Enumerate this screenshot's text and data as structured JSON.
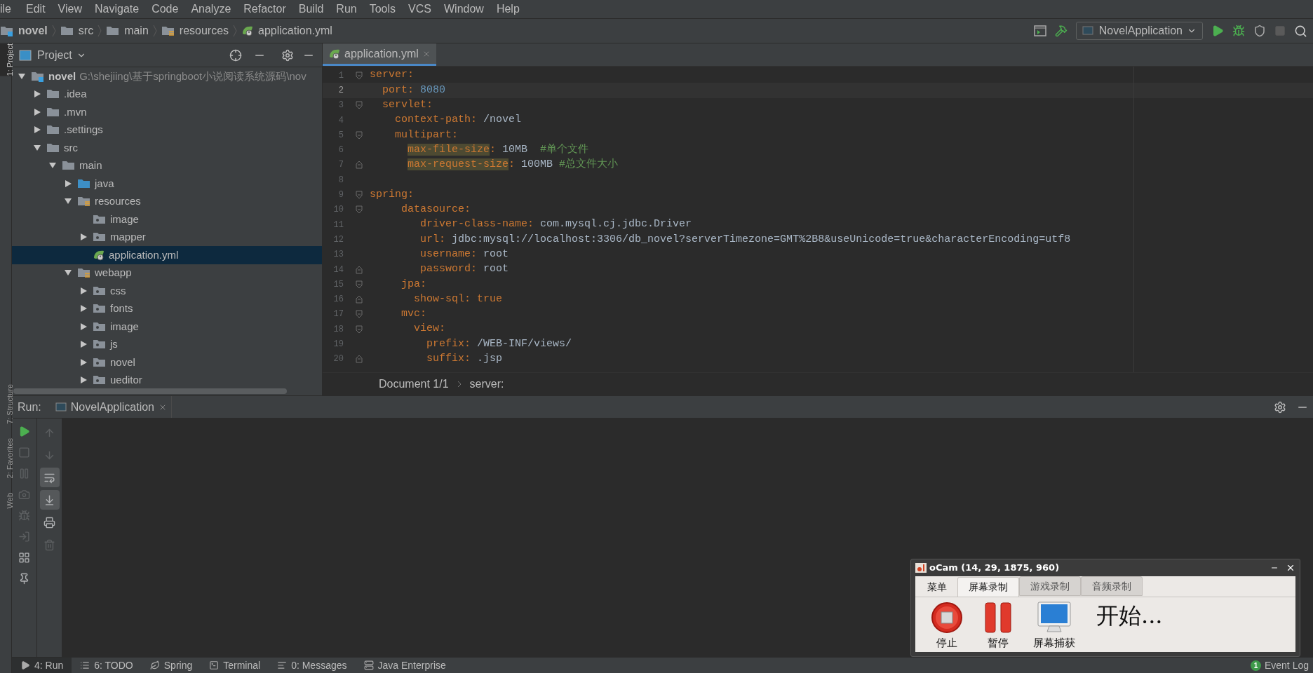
{
  "menu": [
    "ile",
    "Edit",
    "View",
    "Navigate",
    "Code",
    "Analyze",
    "Refactor",
    "Build",
    "Run",
    "Tools",
    "VCS",
    "Window",
    "Help"
  ],
  "breadcrumbs": [
    {
      "label": "novel",
      "kind": "module"
    },
    {
      "label": "src",
      "kind": "folder"
    },
    {
      "label": "main",
      "kind": "folder"
    },
    {
      "label": "resources",
      "kind": "resources"
    },
    {
      "label": "application.yml",
      "kind": "spring"
    }
  ],
  "toolbar": {
    "run_config": "NovelApplication"
  },
  "side_strip": [
    {
      "label": "1: Project",
      "selected": true
    },
    {
      "label": "7: Structure",
      "selected": false
    },
    {
      "label": "2: Favorites",
      "selected": false
    },
    {
      "label": "Web",
      "selected": false
    }
  ],
  "project": {
    "title": "Project",
    "tree": [
      {
        "name": "novel",
        "path": "G:\\shejiing\\基于springboot小说阅读系统源码\\nov",
        "kind": "module",
        "expanded": true,
        "selected": false,
        "children": [
          {
            "name": ".idea",
            "kind": "folder",
            "expanded": false,
            "selected": false
          },
          {
            "name": ".mvn",
            "kind": "folder",
            "expanded": false,
            "selected": false
          },
          {
            "name": ".settings",
            "kind": "folder",
            "expanded": false,
            "selected": false
          },
          {
            "name": "src",
            "kind": "folder",
            "expanded": true,
            "selected": false,
            "children": [
              {
                "name": "main",
                "kind": "folder",
                "expanded": true,
                "selected": false,
                "children": [
                  {
                    "name": "java",
                    "kind": "source",
                    "expanded": false,
                    "selected": false
                  },
                  {
                    "name": "resources",
                    "kind": "resources",
                    "expanded": true,
                    "selected": false,
                    "children": [
                      {
                        "name": "image",
                        "kind": "package",
                        "selected": false
                      },
                      {
                        "name": "mapper",
                        "kind": "package",
                        "expanded": false,
                        "selected": false
                      },
                      {
                        "name": "application.yml",
                        "kind": "spring",
                        "selected": true
                      }
                    ]
                  },
                  {
                    "name": "webapp",
                    "kind": "resources",
                    "expanded": true,
                    "selected": false,
                    "children": [
                      {
                        "name": "css",
                        "kind": "package",
                        "expanded": false,
                        "selected": false
                      },
                      {
                        "name": "fonts",
                        "kind": "package",
                        "expanded": false,
                        "selected": false
                      },
                      {
                        "name": "image",
                        "kind": "package",
                        "expanded": false,
                        "selected": false
                      },
                      {
                        "name": "js",
                        "kind": "package",
                        "expanded": false,
                        "selected": false
                      },
                      {
                        "name": "novel",
                        "kind": "package",
                        "expanded": false,
                        "selected": false
                      },
                      {
                        "name": "ueditor",
                        "kind": "package",
                        "expanded": false,
                        "selected": false
                      }
                    ]
                  }
                ]
              }
            ]
          }
        ]
      }
    ]
  },
  "editor": {
    "tabs": [
      {
        "label": "application.yml",
        "selected": true
      }
    ],
    "lines": [
      {
        "number": "1",
        "kind": "fold-start",
        "current": false,
        "tokens": [
          {
            "kind": "key",
            "text": "server"
          },
          {
            "kind": "punct",
            "text": ":"
          }
        ]
      },
      {
        "number": "2",
        "kind": "plain",
        "current": true,
        "tokens": [
          {
            "kind": "key",
            "text": "  port"
          },
          {
            "kind": "punct",
            "text": ": "
          },
          {
            "kind": "number",
            "text": "8080"
          }
        ]
      },
      {
        "number": "3",
        "kind": "fold-start",
        "current": false,
        "tokens": [
          {
            "kind": "key",
            "text": "  servlet"
          },
          {
            "kind": "punct",
            "text": ":"
          }
        ]
      },
      {
        "number": "4",
        "kind": "plain",
        "current": false,
        "tokens": [
          {
            "kind": "key",
            "text": "    context-path"
          },
          {
            "kind": "punct",
            "text": ": "
          },
          {
            "kind": "value",
            "text": "/novel"
          }
        ]
      },
      {
        "number": "5",
        "kind": "fold-start",
        "current": false,
        "tokens": [
          {
            "kind": "key",
            "text": "    multipart"
          },
          {
            "kind": "punct",
            "text": ":"
          }
        ]
      },
      {
        "number": "6",
        "kind": "plain",
        "current": false,
        "tokens": [
          {
            "kind": "marked-key",
            "text": "      max-file-size"
          },
          {
            "kind": "punct",
            "text": ": "
          },
          {
            "kind": "value",
            "text": "10MB  "
          },
          {
            "kind": "comment",
            "text": "#单个文件"
          }
        ]
      },
      {
        "number": "7",
        "kind": "fold-end",
        "current": false,
        "tokens": [
          {
            "kind": "marked-key",
            "text": "      max-request-size"
          },
          {
            "kind": "punct",
            "text": ": "
          },
          {
            "kind": "value",
            "text": "100MB "
          },
          {
            "kind": "comment",
            "text": "#总文件大小"
          }
        ]
      },
      {
        "number": "8",
        "kind": "plain",
        "current": false
      },
      {
        "number": "9",
        "kind": "fold-start",
        "current": false,
        "tokens": [
          {
            "kind": "key",
            "text": "spring"
          },
          {
            "kind": "punct",
            "text": ":"
          }
        ]
      },
      {
        "number": "10",
        "kind": "fold-start",
        "current": false,
        "tokens": [
          {
            "kind": "key",
            "text": "     datasource"
          },
          {
            "kind": "punct",
            "text": ":"
          }
        ]
      },
      {
        "number": "11",
        "kind": "plain",
        "current": false,
        "tokens": [
          {
            "kind": "key",
            "text": "        driver-class-name"
          },
          {
            "kind": "punct",
            "text": ": "
          },
          {
            "kind": "value",
            "text": "com.mysql.cj.jdbc.Driver"
          }
        ]
      },
      {
        "number": "12",
        "kind": "plain",
        "current": false,
        "tokens": [
          {
            "kind": "key",
            "text": "        url"
          },
          {
            "kind": "punct",
            "text": ": "
          },
          {
            "kind": "value",
            "text": "jdbc:mysql://localhost:3306/db_novel?serverTimezone=GMT%2B8&useUnicode=true&characterEncoding=utf8"
          }
        ]
      },
      {
        "number": "13",
        "kind": "plain",
        "current": false,
        "tokens": [
          {
            "kind": "key",
            "text": "        username"
          },
          {
            "kind": "punct",
            "text": ": "
          },
          {
            "kind": "value",
            "text": "root"
          }
        ]
      },
      {
        "number": "14",
        "kind": "fold-end",
        "current": false,
        "tokens": [
          {
            "kind": "key",
            "text": "        password"
          },
          {
            "kind": "punct",
            "text": ": "
          },
          {
            "kind": "value",
            "text": "root"
          }
        ]
      },
      {
        "number": "15",
        "kind": "fold-start",
        "current": false,
        "tokens": [
          {
            "kind": "key",
            "text": "     jpa"
          },
          {
            "kind": "punct",
            "text": ":"
          }
        ]
      },
      {
        "number": "16",
        "kind": "fold-end",
        "current": false,
        "tokens": [
          {
            "kind": "key",
            "text": "       show-sql"
          },
          {
            "kind": "punct",
            "text": ": "
          },
          {
            "kind": "keyword",
            "text": "true"
          }
        ]
      },
      {
        "number": "17",
        "kind": "fold-start",
        "current": false,
        "tokens": [
          {
            "kind": "key",
            "text": "     mvc"
          },
          {
            "kind": "punct",
            "text": ":"
          }
        ]
      },
      {
        "number": "18",
        "kind": "fold-start",
        "current": false,
        "tokens": [
          {
            "kind": "key",
            "text": "       view"
          },
          {
            "kind": "punct",
            "text": ":"
          }
        ]
      },
      {
        "number": "19",
        "kind": "plain",
        "current": false,
        "tokens": [
          {
            "kind": "key",
            "text": "         prefix"
          },
          {
            "kind": "punct",
            "text": ": "
          },
          {
            "kind": "value",
            "text": "/WEB-INF/views/"
          }
        ]
      },
      {
        "number": "20",
        "kind": "fold-end",
        "current": false,
        "tokens": [
          {
            "kind": "key",
            "text": "         suffix"
          },
          {
            "kind": "punct",
            "text": ": "
          },
          {
            "kind": "value",
            "text": ".jsp"
          }
        ]
      }
    ],
    "breadcrumb": [
      "Document 1/1",
      "server:"
    ]
  },
  "run": {
    "label": "Run:",
    "tabs": [
      {
        "label": "NovelApplication",
        "selected": true
      }
    ],
    "actions": [
      {
        "disabled": false
      },
      {
        "disabled": true
      },
      {
        "disabled": true
      },
      {
        "disabled": true
      },
      {
        "disabled": true
      },
      {
        "disabled": true
      },
      {
        "disabled": false
      },
      {
        "disabled": false
      }
    ],
    "output_actions": [
      {
        "selected": false
      },
      {
        "selected": false
      },
      {
        "selected": true
      },
      {
        "selected": true
      },
      {
        "selected": false
      },
      {
        "selected": false
      }
    ]
  },
  "tool_windows": [
    {
      "label": "4: Run",
      "selected": true
    },
    {
      "label": "6: TODO",
      "selected": false
    },
    {
      "label": "Spring",
      "selected": false
    },
    {
      "label": "Terminal",
      "selected": false
    },
    {
      "label": "0: Messages",
      "selected": false
    },
    {
      "label": "Java Enterprise",
      "selected": false
    }
  ],
  "event_log": {
    "label": "Event Log",
    "count": "1"
  },
  "ocam": {
    "title": "oCam (14, 29, 1875, 960)",
    "tabs": [
      {
        "label": "菜单",
        "selected": false
      },
      {
        "label": "屏幕录制",
        "selected": true
      },
      {
        "label": "游戏录制",
        "selected": false
      },
      {
        "label": "音频录制",
        "selected": false
      }
    ],
    "buttons": [
      {
        "label": "停止",
        "kind": "stop"
      },
      {
        "label": "暂停",
        "kind": "pause"
      },
      {
        "label": "屏幕捕获",
        "kind": "capture"
      }
    ],
    "status": "开始..."
  }
}
